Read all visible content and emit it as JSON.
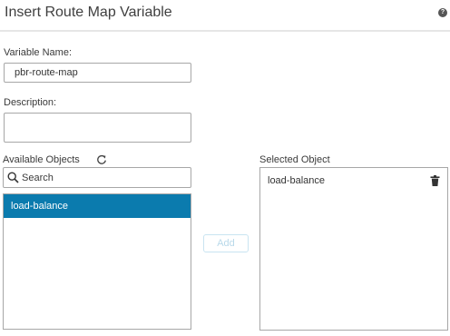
{
  "dialog": {
    "title": "Insert Route Map Variable",
    "help_icon": "help-icon",
    "help_glyph": "?"
  },
  "form": {
    "variable_name_label": "Variable Name:",
    "variable_name_value": "pbr-route-map",
    "description_label": "Description:",
    "description_value": ""
  },
  "available": {
    "label": "Available Objects",
    "refresh_icon": "refresh-icon",
    "search_placeholder": "Search",
    "search_value": "",
    "items": [
      {
        "label": "load-balance",
        "selected": true
      }
    ]
  },
  "add_button_label": "Add",
  "selected": {
    "label": "Selected Object",
    "items": [
      {
        "label": "load-balance",
        "delete_icon": "trash-icon"
      }
    ]
  },
  "colors": {
    "selection": "#0b7bae",
    "add_disabled_text": "#b9d9ea",
    "border": "#a7a7a7"
  }
}
